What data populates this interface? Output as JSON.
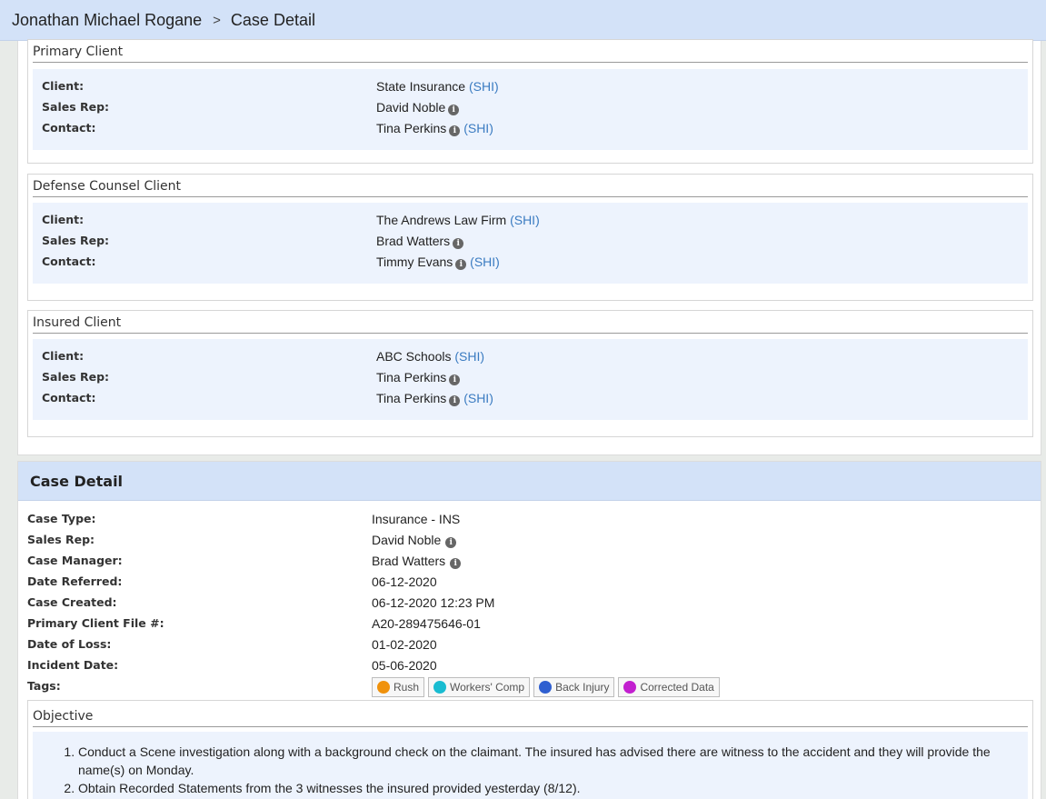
{
  "breadcrumb": {
    "name": "Jonathan Michael Rogane",
    "separator": ">",
    "page": "Case Detail"
  },
  "client_sections": [
    {
      "title": "Primary Client",
      "rows": [
        {
          "label": "Client:",
          "value": "State Insurance",
          "link": "(SHI)",
          "info": false
        },
        {
          "label": "Sales Rep:",
          "value": "David Noble",
          "link": "",
          "info": true
        },
        {
          "label": "Contact:",
          "value": "Tina Perkins",
          "link": "(SHI)",
          "info": true
        }
      ]
    },
    {
      "title": "Defense Counsel Client",
      "rows": [
        {
          "label": "Client:",
          "value": "The Andrews Law Firm",
          "link": "(SHI)",
          "info": false
        },
        {
          "label": "Sales Rep:",
          "value": "Brad Watters",
          "link": "",
          "info": true
        },
        {
          "label": "Contact:",
          "value": "Timmy Evans",
          "link": "(SHI)",
          "info": true
        }
      ]
    },
    {
      "title": "Insured Client",
      "rows": [
        {
          "label": "Client:",
          "value": "ABC Schools",
          "link": "(SHI)",
          "info": false
        },
        {
          "label": "Sales Rep:",
          "value": "Tina Perkins",
          "link": "",
          "info": true
        },
        {
          "label": "Contact:",
          "value": "Tina Perkins",
          "link": "(SHI)",
          "info": true
        }
      ]
    }
  ],
  "case_detail": {
    "title": "Case Detail",
    "rows": [
      {
        "label": "Case Type:",
        "value": "Insurance - INS",
        "info": false
      },
      {
        "label": "Sales Rep:",
        "value": "David Noble",
        "info": true
      },
      {
        "label": "Case Manager:",
        "value": "Brad Watters",
        "info": true
      },
      {
        "label": "Date Referred:",
        "value": "06-12-2020",
        "info": false
      },
      {
        "label": "Case Created:",
        "value": "06-12-2020 12:23 PM",
        "info": false
      },
      {
        "label": "Primary Client File #:",
        "value": "A20-289475646-01",
        "info": false
      },
      {
        "label": "Date of Loss:",
        "value": "01-02-2020",
        "info": false
      },
      {
        "label": "Incident Date:",
        "value": "05-06-2020",
        "info": false
      }
    ],
    "tags_label": "Tags:",
    "tags": [
      {
        "label": "Rush",
        "color": "#f0920c"
      },
      {
        "label": "Workers' Comp",
        "color": "#19bcd1"
      },
      {
        "label": "Back Injury",
        "color": "#2f5fd0"
      },
      {
        "label": "Corrected Data",
        "color": "#c21fcf"
      }
    ],
    "objective": {
      "title": "Objective",
      "items": [
        "Conduct a Scene investigation along with a background check on the claimant.  The insured has advised there are witness to the accident and they will provide the name(s) on Monday.",
        "Obtain Recorded Statements from the 3 witnesses the insured provided yesterday (8/12)."
      ]
    }
  },
  "info_icon_glyph": "i"
}
